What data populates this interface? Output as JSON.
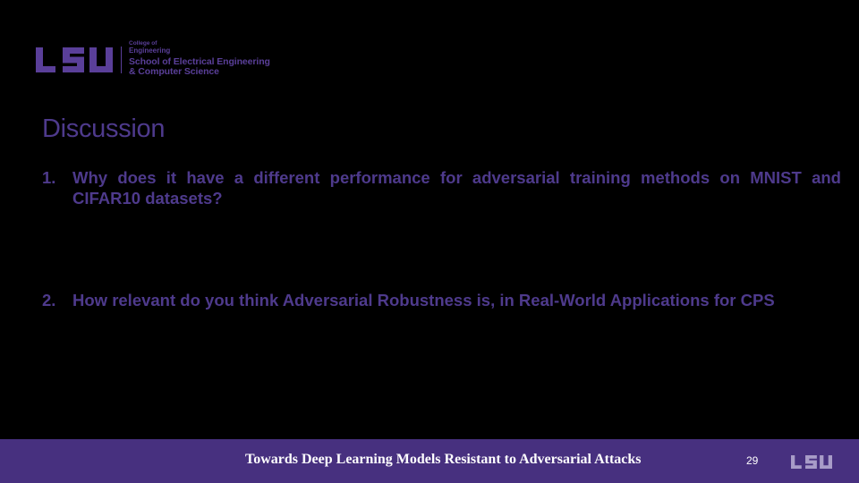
{
  "header": {
    "logo_mark": "LSU",
    "college_of": "College of",
    "engineering": "Engineering",
    "school": "School of Electrical Engineering",
    "computer_science": "& Computer Science"
  },
  "slide": {
    "title": "Discussion",
    "questions": [
      {
        "number": "1.",
        "text": "Why does it have a different performance for adversarial training methods on MNIST and CIFAR10 datasets?"
      },
      {
        "number": "2.",
        "text": "How relevant do you think Adversarial Robustness is, in Real-World Applications for CPS"
      }
    ]
  },
  "footer": {
    "title": "Towards Deep Learning Models Resistant to Adversarial Attacks",
    "page_number": "29",
    "logo_mark": "LSU"
  },
  "colors": {
    "background": "#000000",
    "brand_purple": "#4e3a8c",
    "footer_purple": "#47307f",
    "footer_text": "#ffffff",
    "footer_logo": "#a89cc8"
  }
}
